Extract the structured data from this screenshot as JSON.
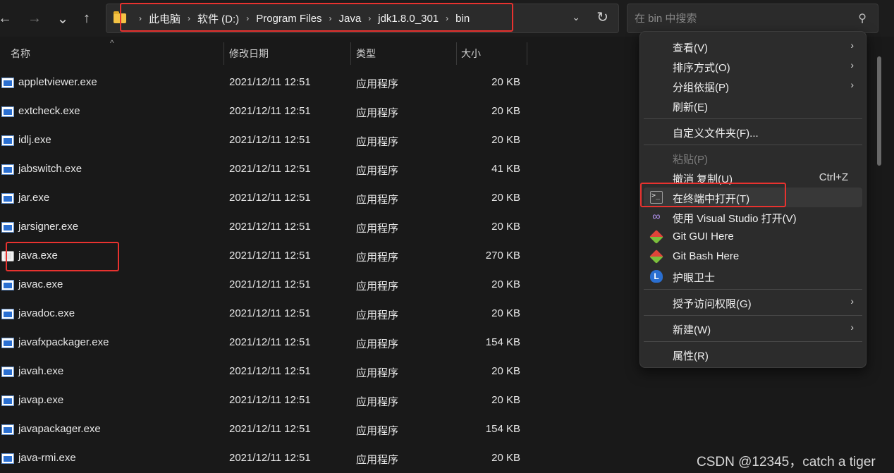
{
  "nav": {
    "back": "←",
    "forward": "→",
    "recent": "⌄",
    "up": "↑"
  },
  "address": {
    "crumbs": [
      "此电脑",
      "软件 (D:)",
      "Program Files",
      "Java",
      "jdk1.8.0_301",
      "bin"
    ],
    "separator": "›"
  },
  "search": {
    "placeholder": "在 bin 中搜索"
  },
  "columns": {
    "name": "名称",
    "date": "修改日期",
    "type": "类型",
    "size": "大小"
  },
  "files": [
    {
      "name": "appletviewer.exe",
      "date": "2021/12/11 12:51",
      "type": "应用程序",
      "size": "20 KB"
    },
    {
      "name": "extcheck.exe",
      "date": "2021/12/11 12:51",
      "type": "应用程序",
      "size": "20 KB"
    },
    {
      "name": "idlj.exe",
      "date": "2021/12/11 12:51",
      "type": "应用程序",
      "size": "20 KB"
    },
    {
      "name": "jabswitch.exe",
      "date": "2021/12/11 12:51",
      "type": "应用程序",
      "size": "41 KB"
    },
    {
      "name": "jar.exe",
      "date": "2021/12/11 12:51",
      "type": "应用程序",
      "size": "20 KB"
    },
    {
      "name": "jarsigner.exe",
      "date": "2021/12/11 12:51",
      "type": "应用程序",
      "size": "20 KB"
    },
    {
      "name": "java.exe",
      "date": "2021/12/11 12:51",
      "type": "应用程序",
      "size": "270 KB"
    },
    {
      "name": "javac.exe",
      "date": "2021/12/11 12:51",
      "type": "应用程序",
      "size": "20 KB"
    },
    {
      "name": "javadoc.exe",
      "date": "2021/12/11 12:51",
      "type": "应用程序",
      "size": "20 KB"
    },
    {
      "name": "javafxpackager.exe",
      "date": "2021/12/11 12:51",
      "type": "应用程序",
      "size": "154 KB"
    },
    {
      "name": "javah.exe",
      "date": "2021/12/11 12:51",
      "type": "应用程序",
      "size": "20 KB"
    },
    {
      "name": "javap.exe",
      "date": "2021/12/11 12:51",
      "type": "应用程序",
      "size": "20 KB"
    },
    {
      "name": "javapackager.exe",
      "date": "2021/12/11 12:51",
      "type": "应用程序",
      "size": "154 KB"
    },
    {
      "name": "java-rmi.exe",
      "date": "2021/12/11 12:51",
      "type": "应用程序",
      "size": "20 KB"
    }
  ],
  "menu": {
    "view": "查看(V)",
    "sort": "排序方式(O)",
    "group": "分组依据(P)",
    "refresh": "刷新(E)",
    "customize": "自定义文件夹(F)...",
    "paste": "粘贴(P)",
    "undo": "撤消 复制(U)",
    "undo_shortcut": "Ctrl+Z",
    "terminal": "在终端中打开(T)",
    "vs": "使用 Visual Studio 打开(V)",
    "git_gui": "Git GUI Here",
    "git_bash": "Git Bash Here",
    "eye_guard": "护眼卫士",
    "access": "授予访问权限(G)",
    "new": "新建(W)",
    "properties": "属性(R)"
  },
  "watermark": "CSDN @12345，catch a tiger",
  "colors": {
    "background": "#191919",
    "menu_bg": "#2c2c2c",
    "highlight_box": "#e8322f"
  }
}
